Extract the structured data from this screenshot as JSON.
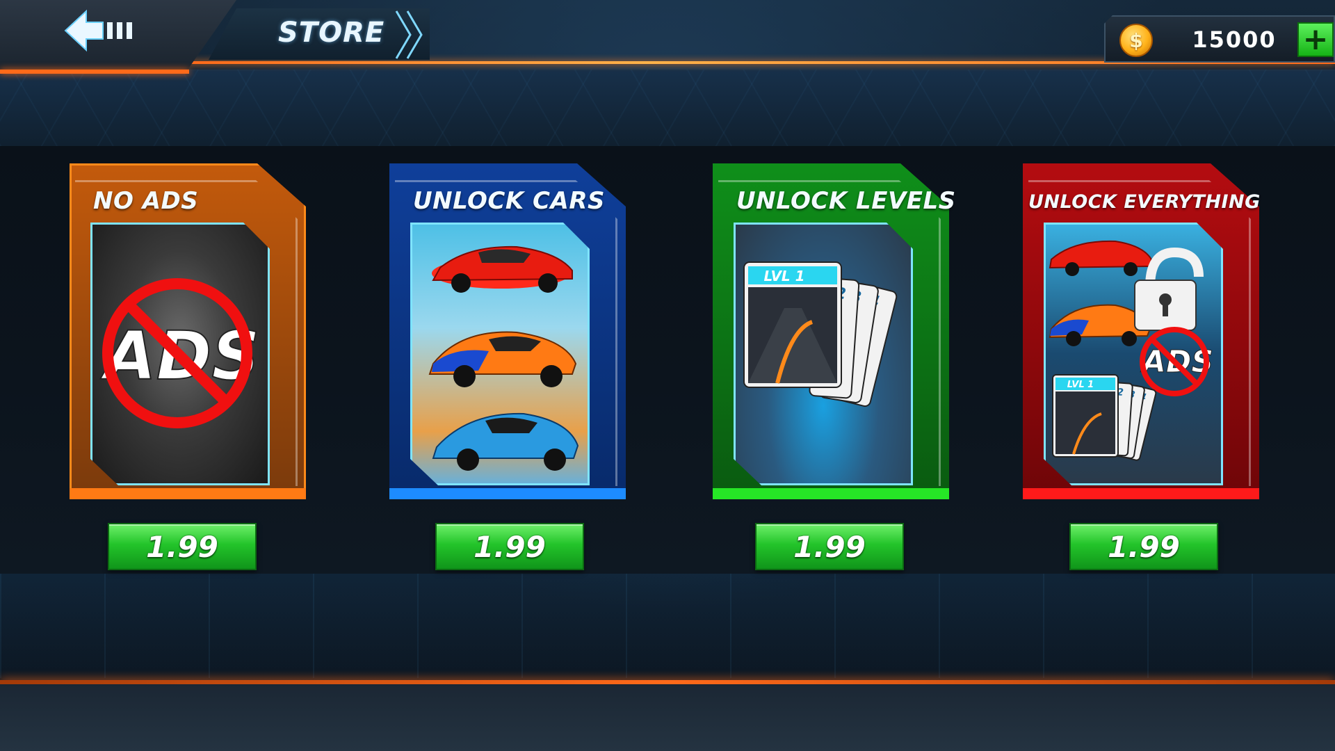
{
  "header": {
    "title": "STORE",
    "back_icon": "back-arrow-icon"
  },
  "wallet": {
    "coin_symbol": "$",
    "balance": "15000",
    "add_label": "+"
  },
  "cards": [
    {
      "title": "NO ADS",
      "price": "1.99",
      "theme": "orange",
      "art": {
        "logo_text": "ADS",
        "icon": "no-ads-icon"
      }
    },
    {
      "title": "UNLOCK CARS",
      "price": "1.99",
      "theme": "blue",
      "art": {
        "icons": [
          "red-sports-car",
          "orange-race-car",
          "blue-hypercar"
        ]
      }
    },
    {
      "title": "UNLOCK LEVELS",
      "price": "1.99",
      "theme": "green",
      "art": {
        "level_label": "LVL 1",
        "card_numbers": [
          "2",
          "3",
          "4"
        ]
      }
    },
    {
      "title": "UNLOCK EVERYTHING",
      "price": "1.99",
      "theme": "red",
      "art": {
        "level_label": "LVL 1",
        "card_numbers": [
          "2",
          "3",
          "4"
        ],
        "logo_text": "ADS",
        "icon": "padlock-open-icon"
      }
    }
  ],
  "colors": {
    "accent_orange": "#ff6a1a",
    "price_green": "#23c42a",
    "card_blue": "#1d8cff",
    "card_green": "#26e626",
    "card_red": "#ff1a1a"
  }
}
